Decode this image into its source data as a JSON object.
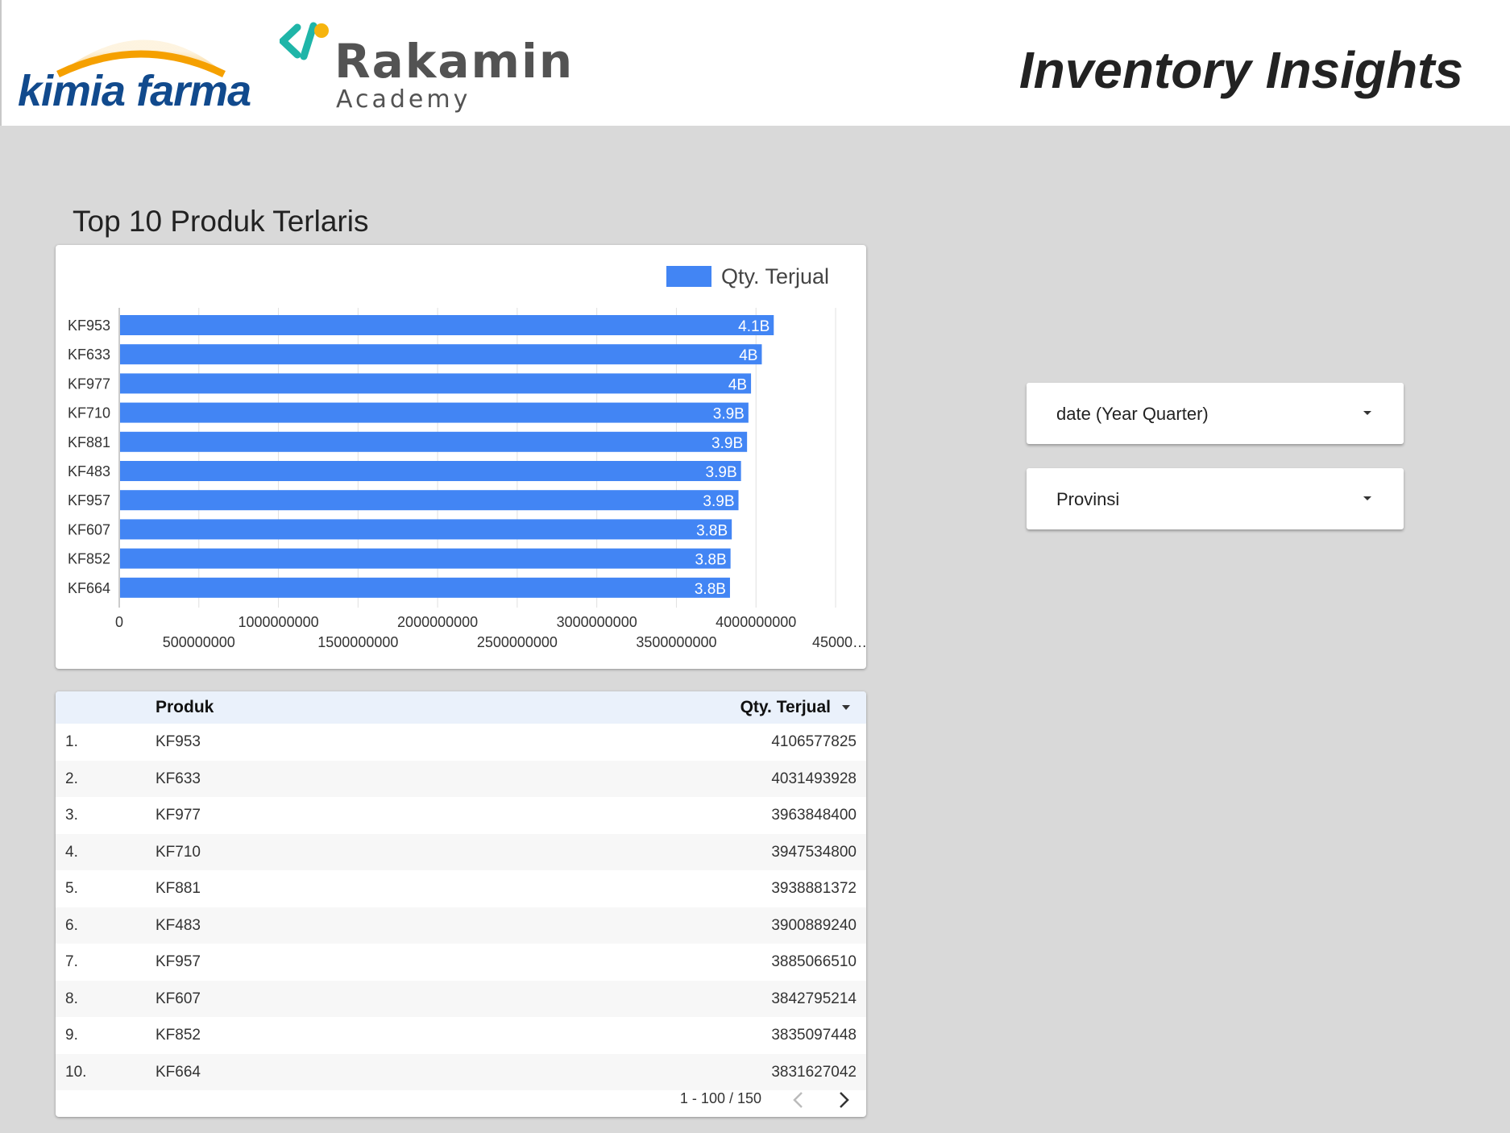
{
  "header": {
    "logo_kimia_farma": "kimia farma",
    "logo_rakamin_name": "Rakamin",
    "logo_rakamin_sub": "Academy",
    "title": "Inventory Insights"
  },
  "section": {
    "title": "Top 10 Produk Terlaris"
  },
  "chart_data": {
    "type": "bar",
    "orientation": "horizontal",
    "legend": {
      "label": "Qty. Terjual",
      "position": "top-right"
    },
    "categories": [
      "KF953",
      "KF633",
      "KF977",
      "KF710",
      "KF881",
      "KF483",
      "KF957",
      "KF607",
      "KF852",
      "KF664"
    ],
    "values": [
      4106577825,
      4031493928,
      3963848400,
      3947534800,
      3938881372,
      3900889240,
      3885066510,
      3842795214,
      3835097448,
      3831627042
    ],
    "data_labels": [
      "4.1B",
      "4B",
      "4B",
      "3.9B",
      "3.9B",
      "3.9B",
      "3.9B",
      "3.8B",
      "3.8B",
      "3.8B"
    ],
    "xlim": [
      0,
      4500000000
    ],
    "x_ticks": [
      0,
      500000000,
      1000000000,
      1500000000,
      2000000000,
      2500000000,
      3000000000,
      3500000000,
      4000000000,
      4500000000
    ],
    "x_tick_labels": [
      "0",
      "500000000",
      "1000000000",
      "1500000000",
      "2000000000",
      "2500000000",
      "3000000000",
      "3500000000",
      "4000000000",
      "45000…"
    ],
    "grid": true,
    "color": "#4285f4"
  },
  "table": {
    "headers": {
      "product": "Produk",
      "qty": "Qty. Terjual"
    },
    "rows": [
      {
        "idx": "1.",
        "product": "KF953",
        "qty": "4106577825"
      },
      {
        "idx": "2.",
        "product": "KF633",
        "qty": "4031493928"
      },
      {
        "idx": "3.",
        "product": "KF977",
        "qty": "3963848400"
      },
      {
        "idx": "4.",
        "product": "KF710",
        "qty": "3947534800"
      },
      {
        "idx": "5.",
        "product": "KF881",
        "qty": "3938881372"
      },
      {
        "idx": "6.",
        "product": "KF483",
        "qty": "3900889240"
      },
      {
        "idx": "7.",
        "product": "KF957",
        "qty": "3885066510"
      },
      {
        "idx": "8.",
        "product": "KF607",
        "qty": "3842795214"
      },
      {
        "idx": "9.",
        "product": "KF852",
        "qty": "3835097448"
      },
      {
        "idx": "10.",
        "product": "KF664",
        "qty": "3831627042"
      }
    ],
    "pagination": "1 - 100 / 150"
  },
  "controls": {
    "date_filter": "date (Year Quarter)",
    "province_filter": "Provinsi"
  },
  "colors": {
    "bar": "#4285f4",
    "kf_blue": "#114a8d",
    "kf_orange": "#f5a000",
    "rakamin_teal": "#1fb5a8",
    "rakamin_yellow": "#f6b40e"
  }
}
